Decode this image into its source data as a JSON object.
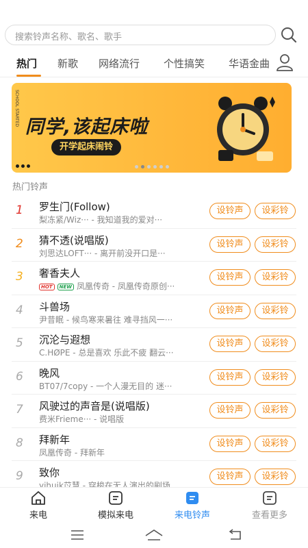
{
  "search": {
    "placeholder": "搜索铃声名称、歌名、歌手",
    "icon": "search-icon"
  },
  "tabs": [
    {
      "label": "热门",
      "active": true
    },
    {
      "label": "新歌",
      "active": false
    },
    {
      "label": "网络流行",
      "active": false
    },
    {
      "label": "个性搞笑",
      "active": false
    },
    {
      "label": "华语金曲",
      "active": false
    }
  ],
  "user_icon": "user-icon",
  "banner": {
    "title": "同学,该起床啦",
    "subtitle": "开学起床闹铃",
    "side_text": "SCHOOL STARTED",
    "slide_count": 6,
    "active_slide": 1
  },
  "section": {
    "title": "热门铃声"
  },
  "buttons": {
    "ringtone": "设铃声",
    "color_ring": "设彩铃"
  },
  "songs": [
    {
      "rank": "1",
      "title": "罗生门(Follow)",
      "subtitle": "梨冻紧/Wiz··· - 我知道我的爱对···",
      "tags": []
    },
    {
      "rank": "2",
      "title": "猜不透(说唱版)",
      "subtitle": "刘思达LOFT··· - 离开前没开口是···",
      "tags": []
    },
    {
      "rank": "3",
      "title": "奢香夫人",
      "subtitle": "凤凰传奇 - 凤凰传奇原创···",
      "tags": [
        "HOT",
        "NEW"
      ]
    },
    {
      "rank": "4",
      "title": "斗兽场",
      "subtitle": "尹昔眠 - 候鸟寒来暑往 难寻挡风一···",
      "tags": []
    },
    {
      "rank": "5",
      "title": "沉沦与遐想",
      "subtitle": "C.HØPE - 总是喜欢 乐此不疲 翻云···",
      "tags": []
    },
    {
      "rank": "6",
      "title": "晚风",
      "subtitle": "BT07/7copy - 一个人漫无目的 迷···",
      "tags": []
    },
    {
      "rank": "7",
      "title": "风驶过的声音是(说唱版)",
      "subtitle": "费米Frieme··· - 说唱版",
      "tags": []
    },
    {
      "rank": "8",
      "title": "拜新年",
      "subtitle": "凤凰传奇 - 拜新年",
      "tags": []
    },
    {
      "rank": "9",
      "title": "致你",
      "subtitle": "yihuik苡慧 - 穿梭在无人演出的剧场",
      "tags": []
    }
  ],
  "bottom_nav": [
    {
      "label": "来电",
      "icon": "home-icon",
      "state": "normal"
    },
    {
      "label": "模拟来电",
      "icon": "message-icon",
      "state": "normal"
    },
    {
      "label": "来电铃声",
      "icon": "ringtone-icon",
      "state": "active"
    },
    {
      "label": "查看更多",
      "icon": "more-icon",
      "state": "muted"
    }
  ],
  "colors": {
    "accent": "#f08c1c",
    "nav_active": "#2f8cf0",
    "rank1": "#e0302a",
    "rank2": "#f08c1c",
    "rank3": "#f5b020"
  }
}
